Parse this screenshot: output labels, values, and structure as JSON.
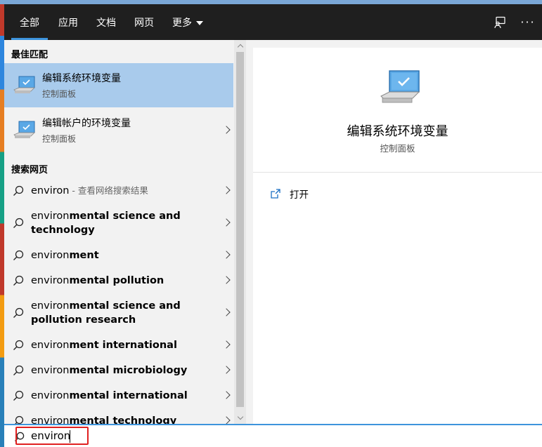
{
  "nav": {
    "tabs": [
      {
        "label": "全部",
        "active": true
      },
      {
        "label": "应用",
        "active": false
      },
      {
        "label": "文档",
        "active": false
      },
      {
        "label": "网页",
        "active": false
      },
      {
        "label": "更多",
        "active": false
      }
    ],
    "feedback_icon": "feedback-icon",
    "more_icon": "ellipsis-icon"
  },
  "best_match": {
    "header": "最佳匹配",
    "items": [
      {
        "title": "编辑系统环境变量",
        "subtitle": "控制面板",
        "selected": true
      },
      {
        "title": "编辑帐户的环境变量",
        "subtitle": "控制面板",
        "selected": false
      }
    ]
  },
  "web_search": {
    "header": "搜索网页",
    "items": [
      {
        "prefix": "environ",
        "suffix": "",
        "hint": " - 查看网络搜索结果"
      },
      {
        "prefix": "environ",
        "suffix": "mental science and technology",
        "hint": ""
      },
      {
        "prefix": "environ",
        "suffix": "ment",
        "hint": ""
      },
      {
        "prefix": "environ",
        "suffix": "mental pollution",
        "hint": ""
      },
      {
        "prefix": "environ",
        "suffix": "mental science and pollution research",
        "hint": ""
      },
      {
        "prefix": "environ",
        "suffix": "ment international",
        "hint": ""
      },
      {
        "prefix": "environ",
        "suffix": "mental microbiology",
        "hint": ""
      },
      {
        "prefix": "environ",
        "suffix": "mental international",
        "hint": ""
      },
      {
        "prefix": "environ",
        "suffix": "mental technology",
        "hint": ""
      }
    ]
  },
  "detail": {
    "title": "编辑系统环境变量",
    "subtitle": "控制面板",
    "actions": [
      {
        "label": "打开",
        "icon": "open-icon"
      }
    ]
  },
  "search": {
    "query": "environ"
  },
  "colors": {
    "accent": "#3d94dc",
    "selected": "#a9cbec",
    "highlight": "#e02020",
    "nav_bg": "#1f1f1f"
  }
}
